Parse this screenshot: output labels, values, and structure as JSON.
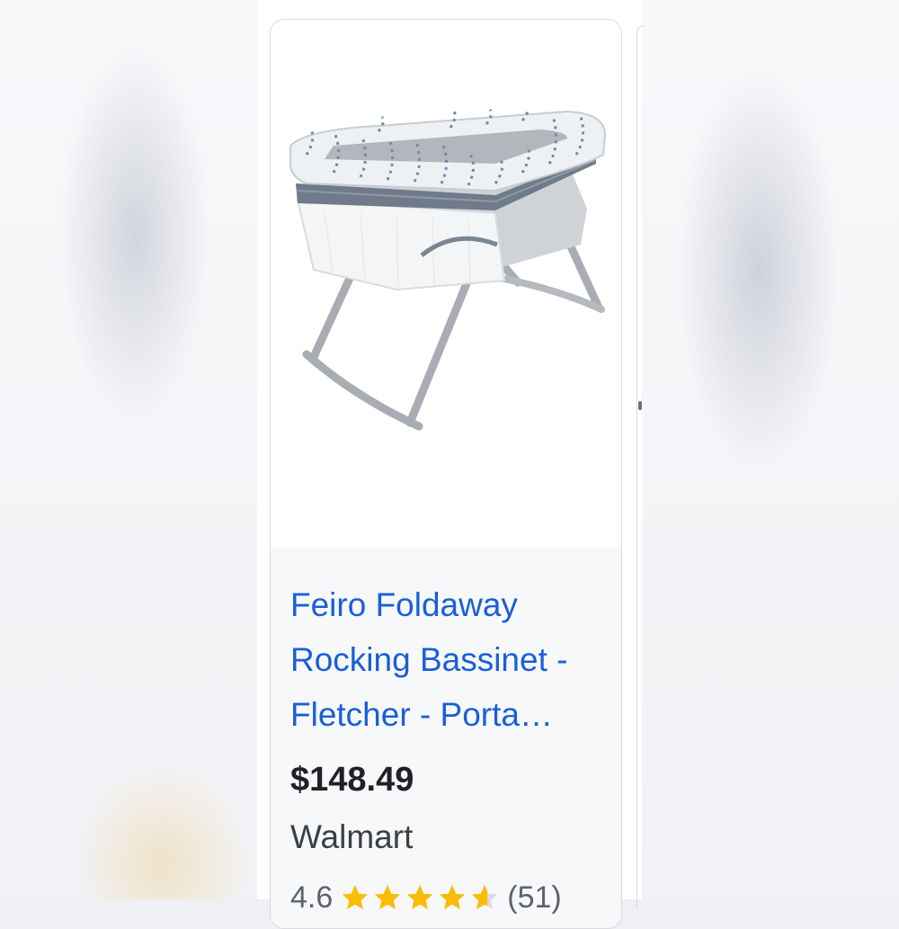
{
  "product": {
    "title": "Feiro Foldaway Rocking Bassinet - Fletcher - Porta…",
    "image_description": "bassinet-product-image",
    "price": "$148.49",
    "store": "Walmart",
    "rating": "4.6",
    "rating_value": 4.6,
    "review_count": "(51)"
  },
  "colors": {
    "title_link": "#1a5fd6",
    "star": "#fbbc04",
    "card_border": "#d7d9de"
  }
}
